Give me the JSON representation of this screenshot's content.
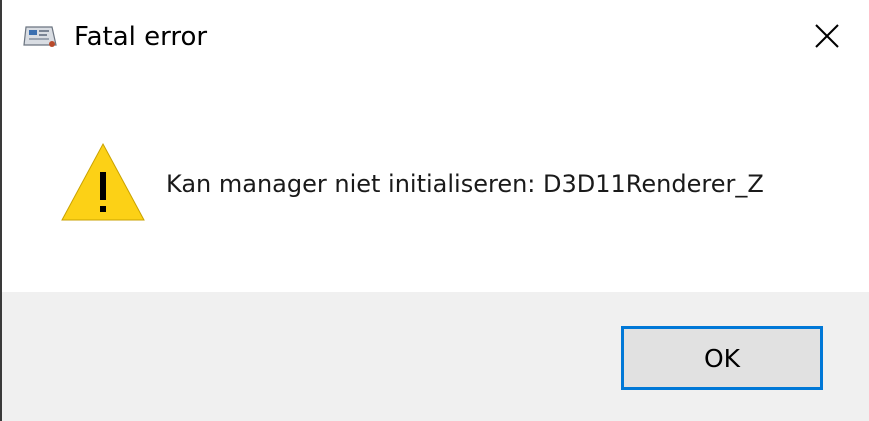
{
  "window": {
    "title": "Fatal error",
    "app_icon": "app-window-icon",
    "close_icon": "close-icon"
  },
  "content": {
    "icon": "warning-icon",
    "message": "Kan manager niet initialiseren: D3D11Renderer_Z"
  },
  "footer": {
    "ok_label": "OK"
  },
  "colors": {
    "warning_fill": "#fcd116",
    "accent_border": "#0078d7",
    "footer_bg": "#f0f0f0",
    "button_bg": "#e1e1e1"
  }
}
